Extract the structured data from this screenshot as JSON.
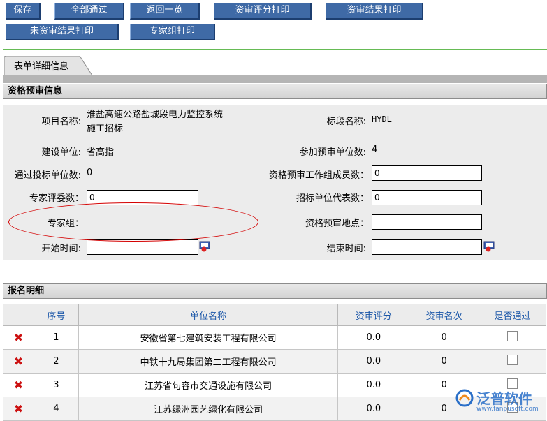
{
  "toolbar": {
    "save": "保存",
    "approve_all": "全部通过",
    "back_list": "返回一览",
    "print_scores": "资审评分打印",
    "print_results": "资审结果打印",
    "print_unreviewed": "未资审结果打印",
    "print_expert_group": "专家组打印"
  },
  "tab": {
    "label": "表单详细信息"
  },
  "prequal": {
    "title": "资格预审信息",
    "project_name_label": "项目名称:",
    "project_name_line1": "淮盐高速公路盐城段电力监控系统",
    "project_name_line2": "施工招标",
    "section_label": "标段名称:",
    "section_value": "HYDL",
    "builder_label": "建设单位:",
    "builder_value": "省高指",
    "participants_label": "参加预审单位数:",
    "participants_value": "4",
    "passed_label": "通过投标单位数:",
    "passed_value": "0",
    "workgroup_label": "资格预审工作组成员数：",
    "workgroup_value": "0",
    "experts_count_label": "专家评委数：",
    "experts_count_value": "0",
    "tenderer_reps_label": "招标单位代表数：",
    "tenderer_reps_value": "0",
    "expert_group_label": "专家组：",
    "location_label": "资格预审地点：",
    "location_value": "",
    "start_label": "开始时间:",
    "start_value": "",
    "end_label": "结束时间:",
    "end_value": ""
  },
  "registration": {
    "title": "报名明细",
    "columns": [
      "序号",
      "单位名称",
      "资审评分",
      "资审名次",
      "是否通过"
    ],
    "rows": [
      {
        "no": "1",
        "name": "安徽省第七建筑安装工程有限公司",
        "score": "0.0",
        "rank": "0"
      },
      {
        "no": "2",
        "name": "中铁十九局集团第二工程有限公司",
        "score": "0.0",
        "rank": "0"
      },
      {
        "no": "3",
        "name": "江苏省句容市交通设施有限公司",
        "score": "0.0",
        "rank": "0"
      },
      {
        "no": "4",
        "name": "江苏绿洲园艺绿化有限公司",
        "score": "0.0",
        "rank": "0"
      }
    ]
  },
  "watermark": {
    "brand": "泛普软件",
    "url": "www.fanpusoft.com"
  },
  "colors": {
    "button": "#3f6aa6",
    "header_text": "#1a56a8",
    "delete": "#cc1111",
    "highlight": "#d40000"
  },
  "icons": {
    "delete": "delete-icon",
    "calendar": "calendar-icon"
  }
}
